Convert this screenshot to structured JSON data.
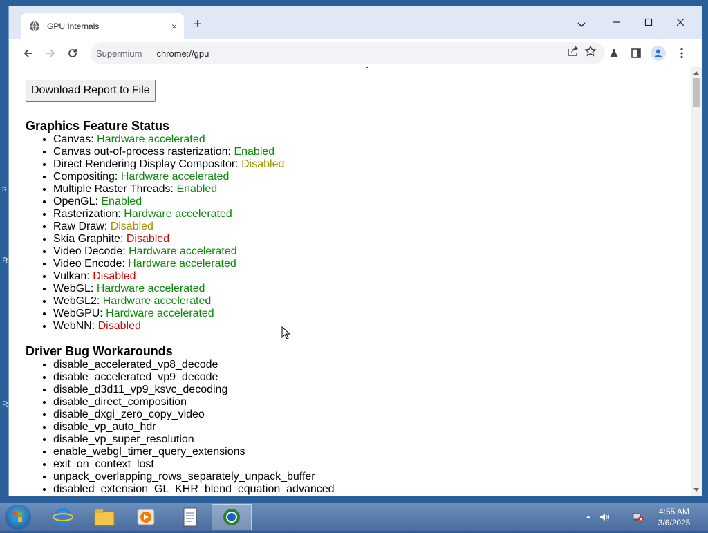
{
  "desktop": {
    "hints": [
      "s",
      "R",
      "R"
    ]
  },
  "browser": {
    "tab_title": "GPU Internals",
    "tab_close": "×",
    "new_tab": "+",
    "window_controls": {
      "minimize": "—",
      "maximize": "☐",
      "close": "✕"
    },
    "omnibox": {
      "site": "Supermium",
      "url": "chrome://gpu"
    }
  },
  "page": {
    "download_button": "Download Report to File",
    "feature_status": {
      "heading": "Graphics Feature Status",
      "items": [
        {
          "name": "Canvas: ",
          "status": "Hardware accelerated",
          "color": "green"
        },
        {
          "name": "Canvas out-of-process rasterization: ",
          "status": "Enabled",
          "color": "green"
        },
        {
          "name": "Direct Rendering Display Compositor: ",
          "status": "Disabled",
          "color": "yellow"
        },
        {
          "name": "Compositing: ",
          "status": "Hardware accelerated",
          "color": "green"
        },
        {
          "name": "Multiple Raster Threads: ",
          "status": "Enabled",
          "color": "green"
        },
        {
          "name": "OpenGL: ",
          "status": "Enabled",
          "color": "green"
        },
        {
          "name": "Rasterization: ",
          "status": "Hardware accelerated",
          "color": "green"
        },
        {
          "name": "Raw Draw: ",
          "status": "Disabled",
          "color": "yellow"
        },
        {
          "name": "Skia Graphite: ",
          "status": "Disabled",
          "color": "red"
        },
        {
          "name": "Video Decode: ",
          "status": "Hardware accelerated",
          "color": "green"
        },
        {
          "name": "Video Encode: ",
          "status": "Hardware accelerated",
          "color": "green"
        },
        {
          "name": "Vulkan: ",
          "status": "Disabled",
          "color": "red"
        },
        {
          "name": "WebGL: ",
          "status": "Hardware accelerated",
          "color": "green"
        },
        {
          "name": "WebGL2: ",
          "status": "Hardware accelerated",
          "color": "green"
        },
        {
          "name": "WebGPU: ",
          "status": "Hardware accelerated",
          "color": "green"
        },
        {
          "name": "WebNN: ",
          "status": "Disabled",
          "color": "red"
        }
      ]
    },
    "workarounds": {
      "heading": "Driver Bug Workarounds",
      "items": [
        "disable_accelerated_vp8_decode",
        "disable_accelerated_vp9_decode",
        "disable_d3d11_vp9_ksvc_decoding",
        "disable_direct_composition",
        "disable_dxgi_zero_copy_video",
        "disable_vp_auto_hdr",
        "disable_vp_super_resolution",
        "enable_webgl_timer_query_extensions",
        "exit_on_context_lost",
        "unpack_overlapping_rows_separately_unpack_buffer",
        "disabled_extension_GL_KHR_blend_equation_advanced"
      ]
    }
  },
  "taskbar": {
    "clock": {
      "time": "4:55 AM",
      "date": "3/6/2025"
    }
  },
  "colors": {
    "green": "#0a8a0a",
    "yellow": "#a18f00",
    "red": "#d50000"
  }
}
